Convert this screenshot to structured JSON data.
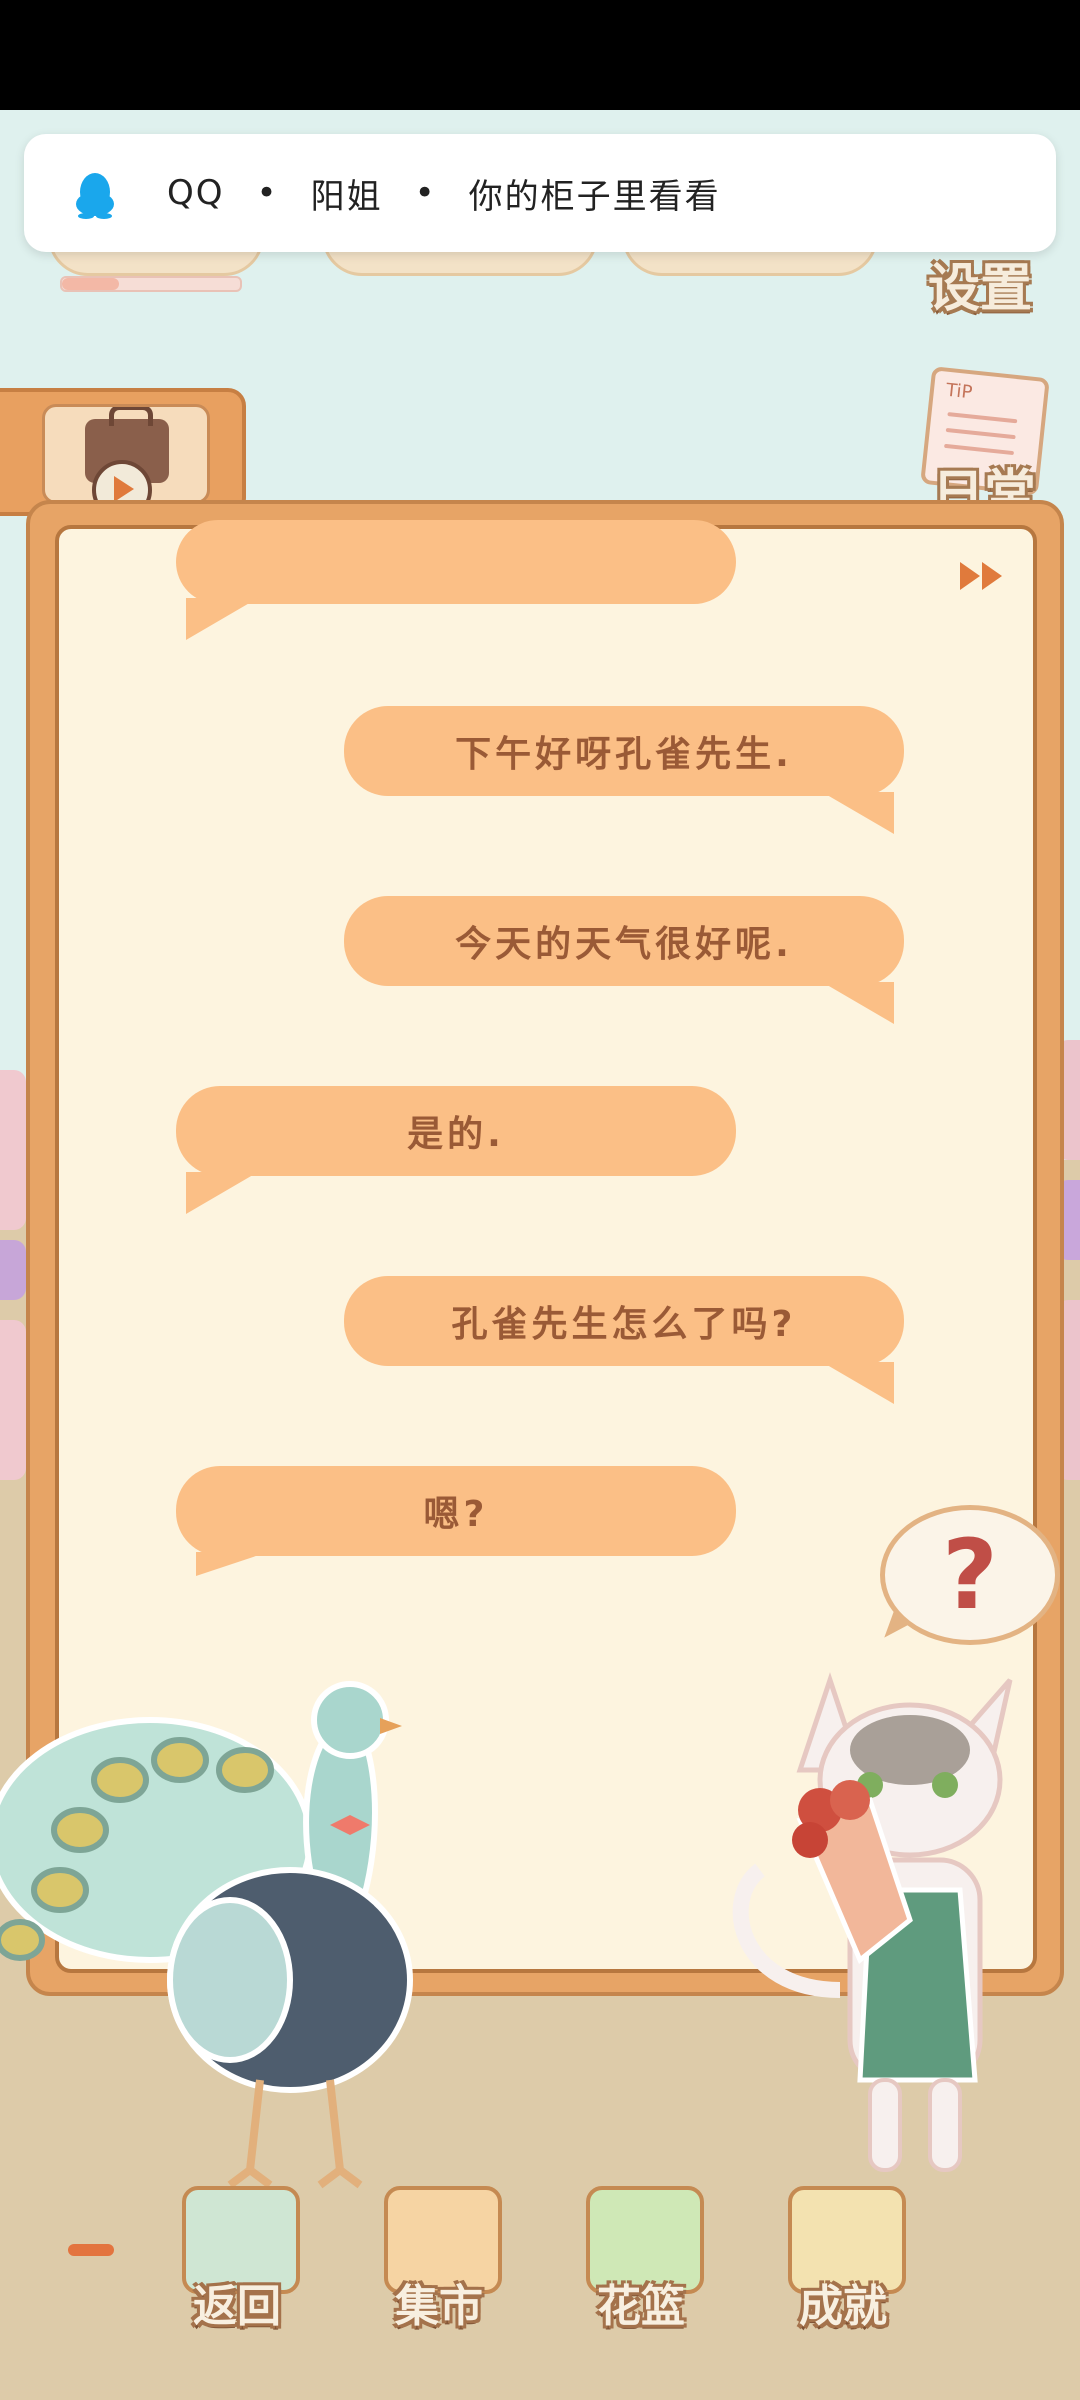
{
  "notification": {
    "app": "QQ",
    "separator": "•",
    "sender": "阳姐",
    "message": "你的柜子里看看"
  },
  "side_buttons": {
    "settings_label": "设置",
    "daily_label": "日常",
    "daily_note_text": "TiP"
  },
  "top_progress": {
    "fraction": 0.32
  },
  "dialog": {
    "bubbles": [
      {
        "side": "right",
        "text": "下午好呀孔雀先生."
      },
      {
        "side": "right",
        "text": "今天的天气很好呢."
      },
      {
        "side": "left",
        "text": "是的."
      },
      {
        "side": "right",
        "text": "孔雀先生怎么了吗?"
      },
      {
        "side": "left",
        "text": "嗯?"
      }
    ],
    "help_symbol": "?"
  },
  "characters": {
    "left": "peacock",
    "right": "cat-florist"
  },
  "bottom_nav": [
    {
      "label": "返回",
      "icon": "door-icon"
    },
    {
      "label": "集市",
      "icon": "market-stall-icon"
    },
    {
      "label": "花篮",
      "icon": "flower-basket-icon"
    },
    {
      "label": "成就",
      "icon": "trophy-icon"
    }
  ],
  "colors": {
    "bubble": "#fbbf86",
    "bubble_text": "#9a5a36",
    "frame": "#e7a466",
    "paper": "#fdf4df",
    "accent": "#e3743f"
  }
}
